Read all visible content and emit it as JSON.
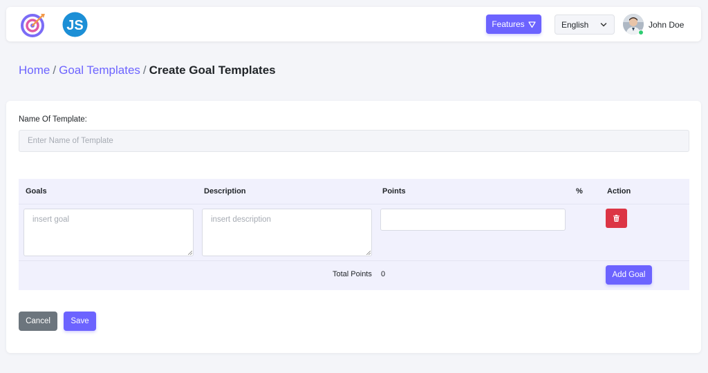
{
  "header": {
    "logo_icon": "target-arrow-icon",
    "js_logo_text": "JS",
    "features_label": "Features",
    "features_icon": "triangle-down-icon",
    "language": "English",
    "user_name": "John Doe",
    "user_status": "online"
  },
  "breadcrumb": {
    "items": [
      "Home",
      "Goal Templates"
    ],
    "separator": "/",
    "current": "Create Goal Templates"
  },
  "form": {
    "name_label": "Name Of Template:",
    "name_placeholder": "Enter Name of Template",
    "name_value": ""
  },
  "table": {
    "columns": [
      "Goals",
      "Description",
      "Points",
      "%",
      "Action"
    ],
    "rows": [
      {
        "goal_placeholder": "insert goal",
        "description_placeholder": "insert description",
        "points_value": "",
        "delete_icon": "trash-icon"
      }
    ],
    "total_label": "Total Points",
    "total_value": "0",
    "add_goal_label": "Add Goal"
  },
  "actions": {
    "cancel_label": "Cancel",
    "save_label": "Save"
  },
  "colors": {
    "accent": "#6c63ff",
    "danger": "#dc3545",
    "secondary": "#6c757d",
    "js_logo": "#1c8fd6",
    "background": "#f4f5f9",
    "table_bg": "#f1f1fd"
  }
}
